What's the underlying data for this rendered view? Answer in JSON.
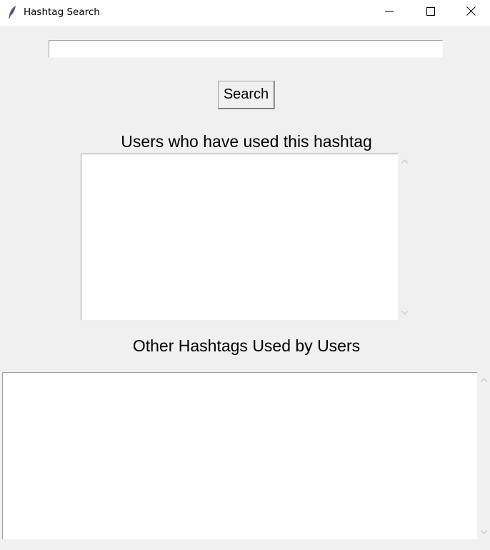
{
  "window": {
    "title": "Hashtag Search",
    "icon": "feather-icon",
    "controls": [
      "minimize-icon",
      "maximize-icon",
      "close-icon"
    ]
  },
  "search": {
    "value": "",
    "button_label": "Search"
  },
  "users_section": {
    "label": "Users who have used this hashtag",
    "items": []
  },
  "other_section": {
    "label": "Other Hashtags Used by Users",
    "items": []
  }
}
